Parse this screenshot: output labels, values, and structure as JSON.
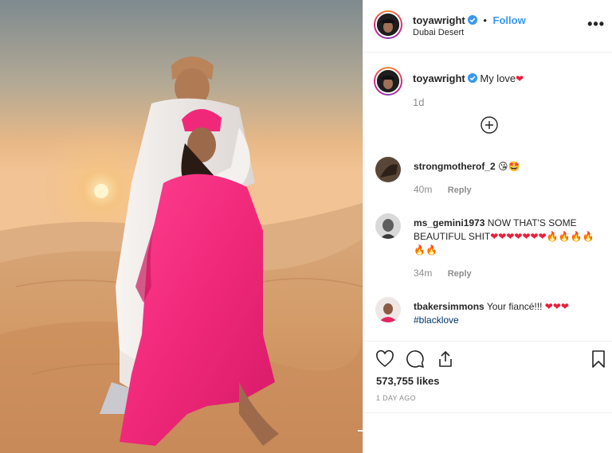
{
  "post": {
    "username": "toyawright",
    "follow_label": "Follow",
    "dot": "•",
    "location": "Dubai Desert",
    "more_label": "•••"
  },
  "caption": {
    "username": "toyawright",
    "text": "My love",
    "emoji": "❤",
    "time": "1d"
  },
  "comments": [
    {
      "username": "strongmotherof_2",
      "text": "",
      "emoji": "😘🤩",
      "time": "40m",
      "reply_label": "Reply"
    },
    {
      "username": "ms_gemini1973",
      "text": "NOW THAT'S SOME BEAUTIFUL SHIT",
      "emoji": "❤❤❤❤❤❤❤🔥🔥🔥🔥🔥🔥",
      "time": "34m",
      "reply_label": "Reply"
    },
    {
      "username": "tbakersimmons",
      "text": "Your fiancé!!!",
      "emoji": "❤❤❤",
      "hashtag": "#blacklove"
    }
  ],
  "engagement": {
    "likes": "573,755 likes",
    "posted": "1 DAY AGO"
  },
  "icons": {
    "like": "heart-icon",
    "comment": "comment-icon",
    "share": "share-icon",
    "save": "bookmark-icon",
    "add": "plus-circle-icon",
    "more": "more-icon",
    "verified": "verified-badge-icon"
  },
  "colors": {
    "link": "#3897f0",
    "verified": "#3897f0",
    "heart": "#ed1c3a",
    "dress": "#f0287a"
  }
}
